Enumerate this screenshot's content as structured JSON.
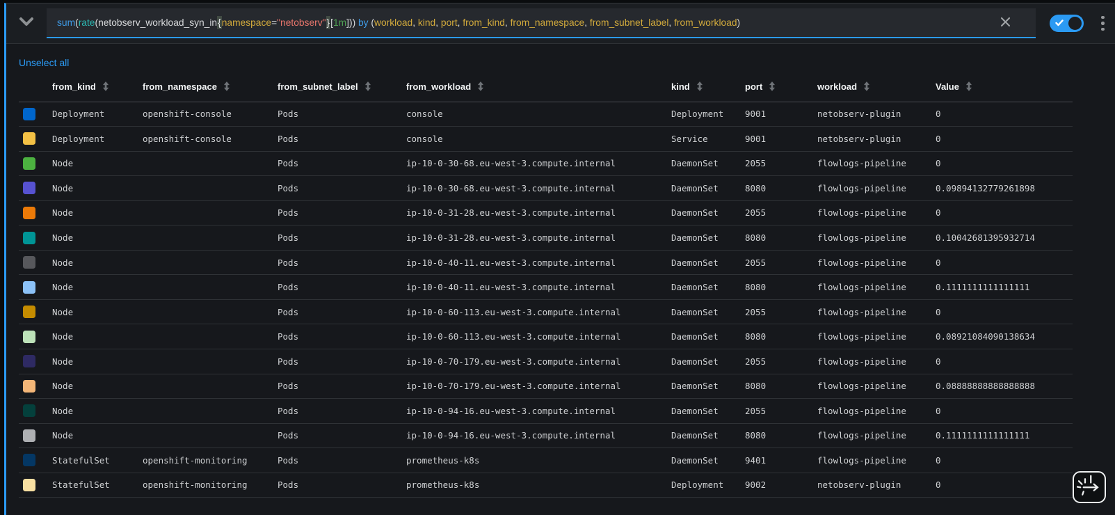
{
  "accent_color": "#2b9af3",
  "query_bar": {
    "tokens": [
      {
        "text": "sum",
        "type": "kw"
      },
      {
        "text": "(",
        "type": "p"
      },
      {
        "text": "rate",
        "type": "fn"
      },
      {
        "text": "(netobserv_workload_syn_in",
        "type": "p"
      },
      {
        "text": "{",
        "type": "brace"
      },
      {
        "text": "namespace",
        "type": "label"
      },
      {
        "text": "=",
        "type": "p"
      },
      {
        "text": "\"netobserv\"",
        "type": "str"
      },
      {
        "text": "}",
        "type": "brace"
      },
      {
        "text": "[",
        "type": "p"
      },
      {
        "text": "1m",
        "type": "dur"
      },
      {
        "text": "])) ",
        "type": "p"
      },
      {
        "text": "by",
        "type": "kw"
      },
      {
        "text": " (",
        "type": "p"
      },
      {
        "text": "workload",
        "type": "label"
      },
      {
        "text": ", ",
        "type": "p"
      },
      {
        "text": "kind",
        "type": "label"
      },
      {
        "text": ", ",
        "type": "p"
      },
      {
        "text": "port",
        "type": "label"
      },
      {
        "text": ", ",
        "type": "p"
      },
      {
        "text": "from_kind",
        "type": "label"
      },
      {
        "text": ", ",
        "type": "p"
      },
      {
        "text": "from_namespace",
        "type": "label"
      },
      {
        "text": ", ",
        "type": "p"
      },
      {
        "text": "from_subnet_label",
        "type": "label"
      },
      {
        "text": ", ",
        "type": "p"
      },
      {
        "text": "from_workload",
        "type": "label"
      },
      {
        "text": ")",
        "type": "p"
      }
    ],
    "switch_on": true
  },
  "table": {
    "unselect_all_label": "Unselect all",
    "columns": [
      {
        "key": "from_kind",
        "label": "from_kind"
      },
      {
        "key": "from_namespace",
        "label": "from_namespace"
      },
      {
        "key": "from_subnet_label",
        "label": "from_subnet_label"
      },
      {
        "key": "from_workload",
        "label": "from_workload"
      },
      {
        "key": "kind",
        "label": "kind"
      },
      {
        "key": "port",
        "label": "port"
      },
      {
        "key": "workload",
        "label": "workload"
      },
      {
        "key": "value",
        "label": "Value"
      }
    ],
    "rows": [
      {
        "color": "#0066CC",
        "from_kind": "Deployment",
        "from_namespace": "openshift-console",
        "from_subnet_label": "Pods",
        "from_workload": "console",
        "kind": "Deployment",
        "port": "9001",
        "workload": "netobserv-plugin",
        "value": "0"
      },
      {
        "color": "#F4C145",
        "from_kind": "Deployment",
        "from_namespace": "openshift-console",
        "from_subnet_label": "Pods",
        "from_workload": "console",
        "kind": "Service",
        "port": "9001",
        "workload": "netobserv-plugin",
        "value": "0"
      },
      {
        "color": "#4CB140",
        "from_kind": "Node",
        "from_namespace": "",
        "from_subnet_label": "Pods",
        "from_workload": "ip-10-0-30-68.eu-west-3.compute.internal",
        "kind": "DaemonSet",
        "port": "2055",
        "workload": "flowlogs-pipeline",
        "value": "0"
      },
      {
        "color": "#5752D1",
        "from_kind": "Node",
        "from_namespace": "",
        "from_subnet_label": "Pods",
        "from_workload": "ip-10-0-30-68.eu-west-3.compute.internal",
        "kind": "DaemonSet",
        "port": "8080",
        "workload": "flowlogs-pipeline",
        "value": "0.09894132779261898"
      },
      {
        "color": "#EC7A08",
        "from_kind": "Node",
        "from_namespace": "",
        "from_subnet_label": "Pods",
        "from_workload": "ip-10-0-31-28.eu-west-3.compute.internal",
        "kind": "DaemonSet",
        "port": "2055",
        "workload": "flowlogs-pipeline",
        "value": "0"
      },
      {
        "color": "#009596",
        "from_kind": "Node",
        "from_namespace": "",
        "from_subnet_label": "Pods",
        "from_workload": "ip-10-0-31-28.eu-west-3.compute.internal",
        "kind": "DaemonSet",
        "port": "8080",
        "workload": "flowlogs-pipeline",
        "value": "0.10042681395932714"
      },
      {
        "color": "#57585C",
        "from_kind": "Node",
        "from_namespace": "",
        "from_subnet_label": "Pods",
        "from_workload": "ip-10-0-40-11.eu-west-3.compute.internal",
        "kind": "DaemonSet",
        "port": "2055",
        "workload": "flowlogs-pipeline",
        "value": "0"
      },
      {
        "color": "#8BC1F7",
        "from_kind": "Node",
        "from_namespace": "",
        "from_subnet_label": "Pods",
        "from_workload": "ip-10-0-40-11.eu-west-3.compute.internal",
        "kind": "DaemonSet",
        "port": "8080",
        "workload": "flowlogs-pipeline",
        "value": "0.1111111111111111"
      },
      {
        "color": "#C58C00",
        "from_kind": "Node",
        "from_namespace": "",
        "from_subnet_label": "Pods",
        "from_workload": "ip-10-0-60-113.eu-west-3.compute.internal",
        "kind": "DaemonSet",
        "port": "2055",
        "workload": "flowlogs-pipeline",
        "value": "0"
      },
      {
        "color": "#BDE2B9",
        "from_kind": "Node",
        "from_namespace": "",
        "from_subnet_label": "Pods",
        "from_workload": "ip-10-0-60-113.eu-west-3.compute.internal",
        "kind": "DaemonSet",
        "port": "8080",
        "workload": "flowlogs-pipeline",
        "value": "0.08921084090138634"
      },
      {
        "color": "#2E2A63",
        "from_kind": "Node",
        "from_namespace": "",
        "from_subnet_label": "Pods",
        "from_workload": "ip-10-0-70-179.eu-west-3.compute.internal",
        "kind": "DaemonSet",
        "port": "2055",
        "workload": "flowlogs-pipeline",
        "value": "0"
      },
      {
        "color": "#F4B678",
        "from_kind": "Node",
        "from_namespace": "",
        "from_subnet_label": "Pods",
        "from_workload": "ip-10-0-70-179.eu-west-3.compute.internal",
        "kind": "DaemonSet",
        "port": "8080",
        "workload": "flowlogs-pipeline",
        "value": "0.08888888888888888"
      },
      {
        "color": "#04403C",
        "from_kind": "Node",
        "from_namespace": "",
        "from_subnet_label": "Pods",
        "from_workload": "ip-10-0-94-16.eu-west-3.compute.internal",
        "kind": "DaemonSet",
        "port": "2055",
        "workload": "flowlogs-pipeline",
        "value": "0"
      },
      {
        "color": "#AEB0B3",
        "from_kind": "Node",
        "from_namespace": "",
        "from_subnet_label": "Pods",
        "from_workload": "ip-10-0-94-16.eu-west-3.compute.internal",
        "kind": "DaemonSet",
        "port": "8080",
        "workload": "flowlogs-pipeline",
        "value": "0.1111111111111111"
      },
      {
        "color": "#043764",
        "from_kind": "StatefulSet",
        "from_namespace": "openshift-monitoring",
        "from_subnet_label": "Pods",
        "from_workload": "prometheus-k8s",
        "kind": "DaemonSet",
        "port": "9401",
        "workload": "flowlogs-pipeline",
        "value": "0"
      },
      {
        "color": "#F9E0A2",
        "from_kind": "StatefulSet",
        "from_namespace": "openshift-monitoring",
        "from_subnet_label": "Pods",
        "from_workload": "prometheus-k8s",
        "kind": "Deployment",
        "port": "9002",
        "workload": "netobserv-plugin",
        "value": "0"
      }
    ]
  }
}
